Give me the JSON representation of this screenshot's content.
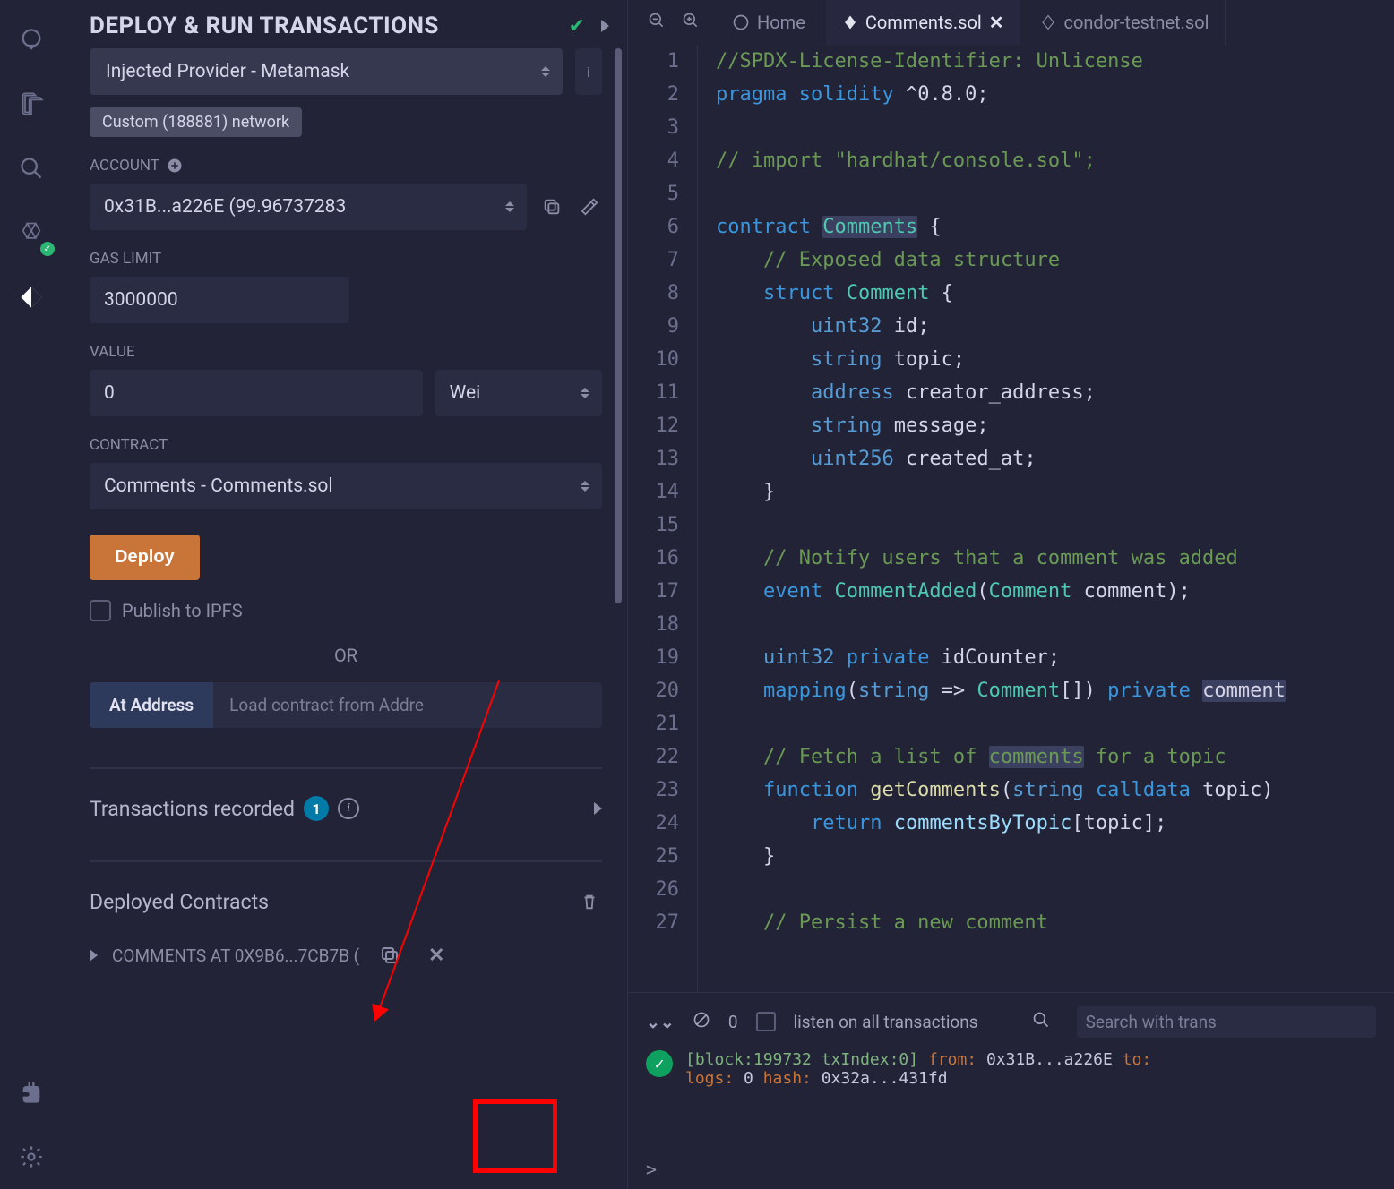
{
  "header": {
    "title": "DEPLOY & RUN TRANSACTIONS"
  },
  "environment": {
    "provider": "Injected Provider - Metamask",
    "network_chip": "Custom (188881) network"
  },
  "account": {
    "label": "ACCOUNT",
    "value": "0x31B...a226E (99.96737283"
  },
  "gas": {
    "label": "GAS LIMIT",
    "value": "3000000"
  },
  "value": {
    "label": "VALUE",
    "amount": "0",
    "unit": "Wei"
  },
  "contract": {
    "label": "CONTRACT",
    "selected": "Comments - Comments.sol"
  },
  "deploy": {
    "button": "Deploy",
    "publish": "Publish to IPFS"
  },
  "or_text": "OR",
  "at_address": {
    "button": "At Address",
    "placeholder": "Load contract from Addre"
  },
  "tx_recorded": {
    "label": "Transactions recorded",
    "count": "1"
  },
  "deployed": {
    "heading": "Deployed Contracts",
    "item": "COMMENTS AT 0X9B6...7CB7B ("
  },
  "tabs": {
    "home": "Home",
    "file1": "Comments.sol",
    "file2": "condor-testnet.sol"
  },
  "terminal": {
    "count": "0",
    "listen": "listen on all transactions",
    "search_ph": "Search with trans",
    "log_line1": "[block:199732 txIndex:0]  from:  0x31B...a226E to:",
    "log_line2": "logs: 0 hash: 0x32a...431fd",
    "prompt": ">"
  },
  "code_lines": [
    "//SPDX-License-Identifier: Unlicense",
    "pragma solidity ^0.8.0;",
    "",
    "// import \"hardhat/console.sol\";",
    "",
    "contract Comments {",
    "    // Exposed data structure",
    "    struct Comment {",
    "        uint32 id;",
    "        string topic;",
    "        address creator_address;",
    "        string message;",
    "        uint256 created_at;",
    "    }",
    "",
    "    // Notify users that a comment was added",
    "    event CommentAdded(Comment comment);",
    "",
    "    uint32 private idCounter;",
    "    mapping(string => Comment[]) private comment",
    "",
    "    // Fetch a list of comments for a topic",
    "    function getComments(string calldata topic)",
    "        return commentsByTopic[topic];",
    "    }",
    "",
    "    // Persist a new comment"
  ]
}
